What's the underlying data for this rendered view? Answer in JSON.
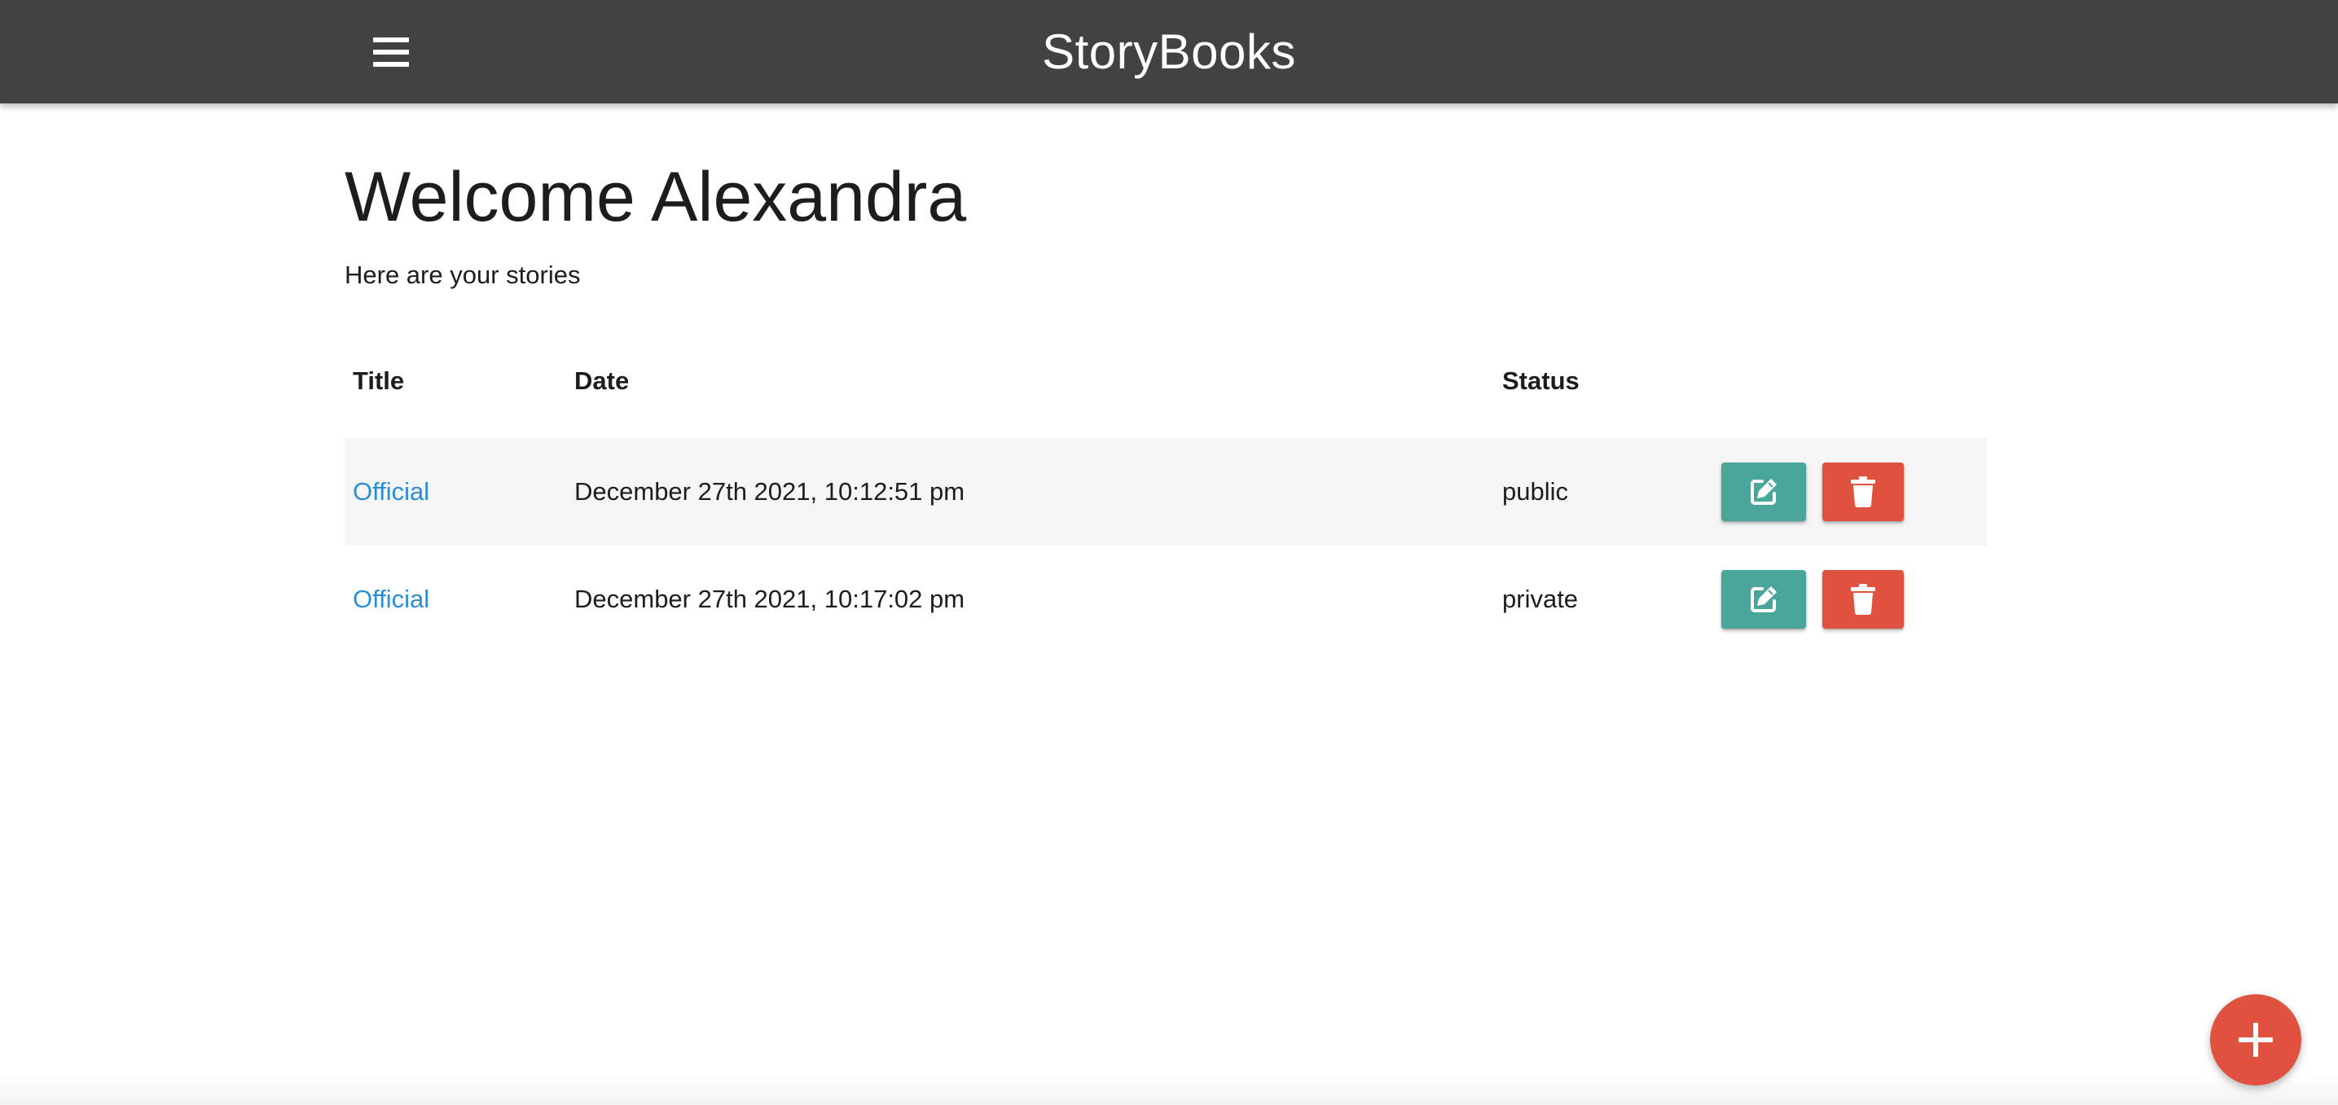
{
  "navbar": {
    "brand": "StoryBooks",
    "menu_icon": "hamburger-menu-icon",
    "background": "#424242"
  },
  "main": {
    "heading": "Welcome Alexandra",
    "subtitle": "Here are your stories"
  },
  "table": {
    "headers": {
      "title": "Title",
      "date": "Date",
      "status": "Status"
    },
    "rows": [
      {
        "title": "Official",
        "date": "December 27th 2021, 10:12:51 pm",
        "status": "public",
        "edit_icon": "edit-icon",
        "delete_icon": "trash-icon"
      },
      {
        "title": "Official",
        "date": "December 27th 2021, 10:17:02 pm",
        "status": "private",
        "edit_icon": "edit-icon",
        "delete_icon": "trash-icon"
      }
    ]
  },
  "fab": {
    "icon": "plus-icon"
  },
  "colors": {
    "link": "#2c8ed1",
    "edit_button": "#4aa69a",
    "delete_button": "#e1513f",
    "fab": "#e1513f",
    "row_stripe": "#f5f5f5"
  }
}
